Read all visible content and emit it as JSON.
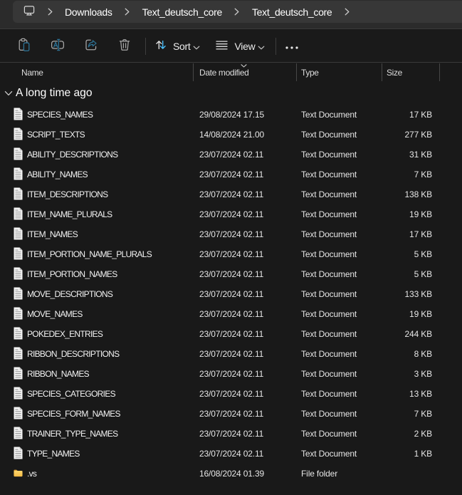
{
  "colors": {
    "nav_band": "#2b2b2b",
    "address_bar": "#373737",
    "content_background": "#191919",
    "divider": "#3a3a3a",
    "accent_blue_bright": "#4cc2ff",
    "accent_blue_steel": "#2e7396",
    "folder_yellow_dark": "#dfa033",
    "folder_yellow_light": "#ffd76d",
    "text_white": "#f2f2f2"
  },
  "breadcrumb": {
    "root_icon": "this-pc-monitor",
    "items": [
      "Downloads",
      "Text_deutsch_core",
      "Text_deutsch_core"
    ]
  },
  "toolbar": {
    "paste": "Paste",
    "rename": "Rename",
    "share": "Share",
    "delete": "Delete",
    "sort_label": "Sort",
    "view_label": "View",
    "more": "See more"
  },
  "columns": {
    "name": "Name",
    "date_modified": "Date modified",
    "type": "Type",
    "size": "Size",
    "sorted_by": "Date modified",
    "sort_direction": "descending"
  },
  "group": {
    "label": "A long time ago",
    "expanded": true
  },
  "files": [
    {
      "name": "SPECIES_NAMES",
      "date": "29/08/2024 17.15",
      "type": "Text Document",
      "size": "17 KB",
      "icon": "text-document"
    },
    {
      "name": "SCRIPT_TEXTS",
      "date": "14/08/2024 21.00",
      "type": "Text Document",
      "size": "277 KB",
      "icon": "text-document"
    },
    {
      "name": "ABILITY_DESCRIPTIONS",
      "date": "23/07/2024 02.11",
      "type": "Text Document",
      "size": "31 KB",
      "icon": "text-document"
    },
    {
      "name": "ABILITY_NAMES",
      "date": "23/07/2024 02.11",
      "type": "Text Document",
      "size": "7 KB",
      "icon": "text-document"
    },
    {
      "name": "ITEM_DESCRIPTIONS",
      "date": "23/07/2024 02.11",
      "type": "Text Document",
      "size": "138 KB",
      "icon": "text-document"
    },
    {
      "name": "ITEM_NAME_PLURALS",
      "date": "23/07/2024 02.11",
      "type": "Text Document",
      "size": "19 KB",
      "icon": "text-document"
    },
    {
      "name": "ITEM_NAMES",
      "date": "23/07/2024 02.11",
      "type": "Text Document",
      "size": "17 KB",
      "icon": "text-document"
    },
    {
      "name": "ITEM_PORTION_NAME_PLURALS",
      "date": "23/07/2024 02.11",
      "type": "Text Document",
      "size": "5 KB",
      "icon": "text-document"
    },
    {
      "name": "ITEM_PORTION_NAMES",
      "date": "23/07/2024 02.11",
      "type": "Text Document",
      "size": "5 KB",
      "icon": "text-document"
    },
    {
      "name": "MOVE_DESCRIPTIONS",
      "date": "23/07/2024 02.11",
      "type": "Text Document",
      "size": "133 KB",
      "icon": "text-document"
    },
    {
      "name": "MOVE_NAMES",
      "date": "23/07/2024 02.11",
      "type": "Text Document",
      "size": "19 KB",
      "icon": "text-document"
    },
    {
      "name": "POKEDEX_ENTRIES",
      "date": "23/07/2024 02.11",
      "type": "Text Document",
      "size": "244 KB",
      "icon": "text-document"
    },
    {
      "name": "RIBBON_DESCRIPTIONS",
      "date": "23/07/2024 02.11",
      "type": "Text Document",
      "size": "8 KB",
      "icon": "text-document"
    },
    {
      "name": "RIBBON_NAMES",
      "date": "23/07/2024 02.11",
      "type": "Text Document",
      "size": "3 KB",
      "icon": "text-document"
    },
    {
      "name": "SPECIES_CATEGORIES",
      "date": "23/07/2024 02.11",
      "type": "Text Document",
      "size": "13 KB",
      "icon": "text-document"
    },
    {
      "name": "SPECIES_FORM_NAMES",
      "date": "23/07/2024 02.11",
      "type": "Text Document",
      "size": "7 KB",
      "icon": "text-document"
    },
    {
      "name": "TRAINER_TYPE_NAMES",
      "date": "23/07/2024 02.11",
      "type": "Text Document",
      "size": "2 KB",
      "icon": "text-document"
    },
    {
      "name": "TYPE_NAMES",
      "date": "23/07/2024 02.11",
      "type": "Text Document",
      "size": "1 KB",
      "icon": "text-document"
    },
    {
      "name": ".vs",
      "date": "16/08/2024 01.39",
      "type": "File folder",
      "size": "",
      "icon": "folder"
    }
  ]
}
